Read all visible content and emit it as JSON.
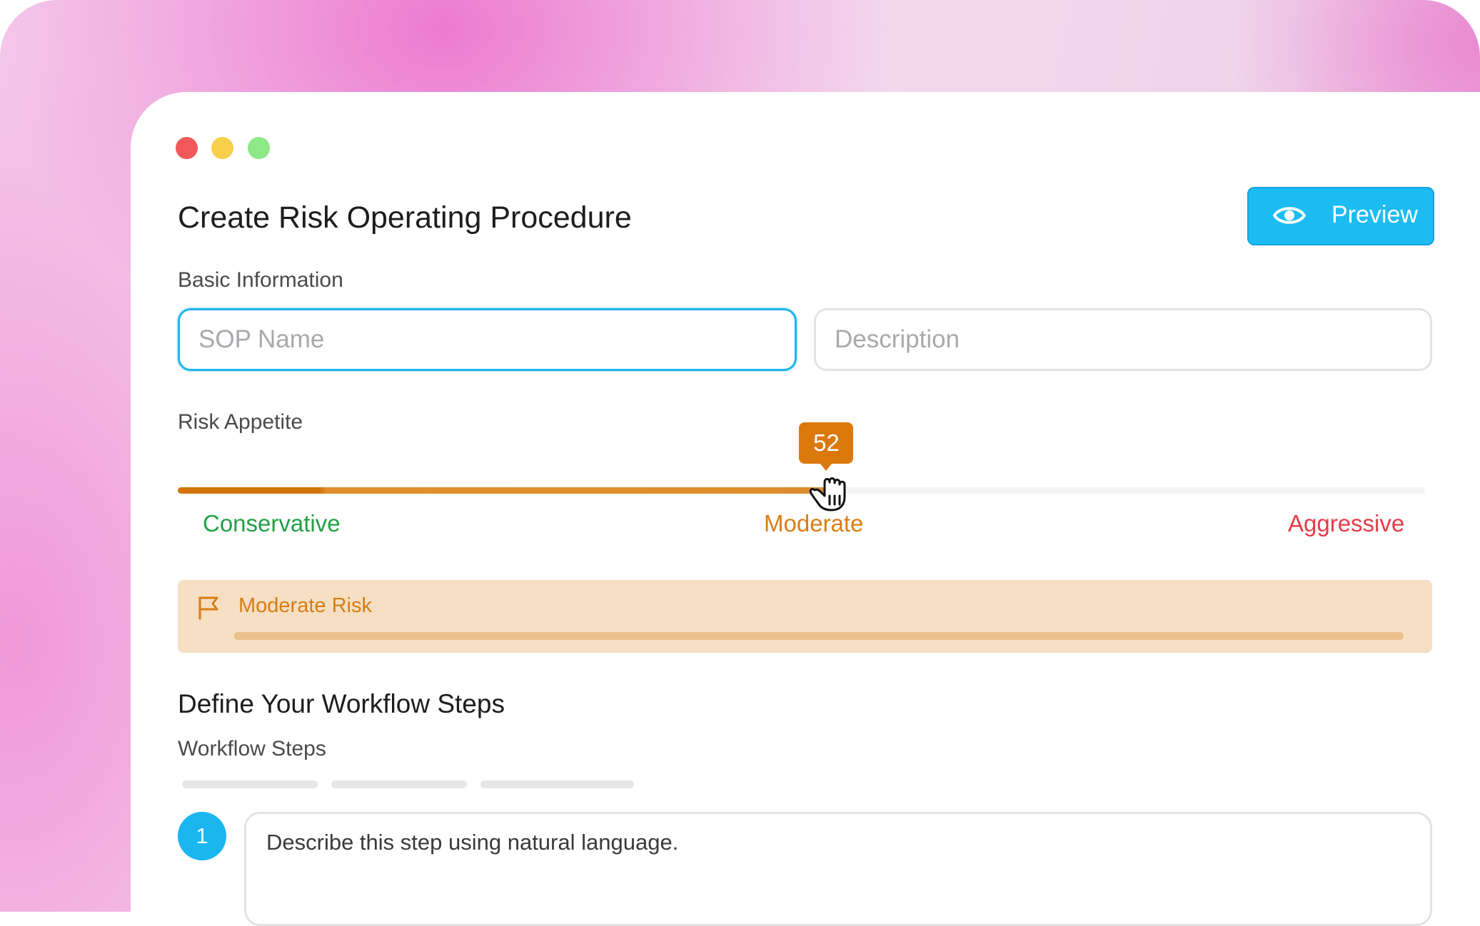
{
  "window": {
    "title": "Create Risk Operating Procedure",
    "preview_label": "Preview"
  },
  "basic_info": {
    "label": "Basic Information",
    "sop_name_placeholder": "SOP Name",
    "description_placeholder": "Description"
  },
  "risk_appetite": {
    "label": "Risk Appetite",
    "value": 52,
    "min": 0,
    "max": 100,
    "scale_labels": {
      "low": "Conservative",
      "mid": "Moderate",
      "high": "Aggressive"
    },
    "banner_text": "Moderate Risk",
    "colors": {
      "low": "#22a146",
      "mid": "#dc7d12",
      "high": "#e53c46"
    }
  },
  "workflow": {
    "heading": "Define Your Workflow Steps",
    "label": "Workflow Steps",
    "steps": [
      {
        "number": "1",
        "text": "Describe this step using natural language."
      }
    ]
  },
  "colors": {
    "accent": "#1cbcf3",
    "warning": "#db780b"
  }
}
